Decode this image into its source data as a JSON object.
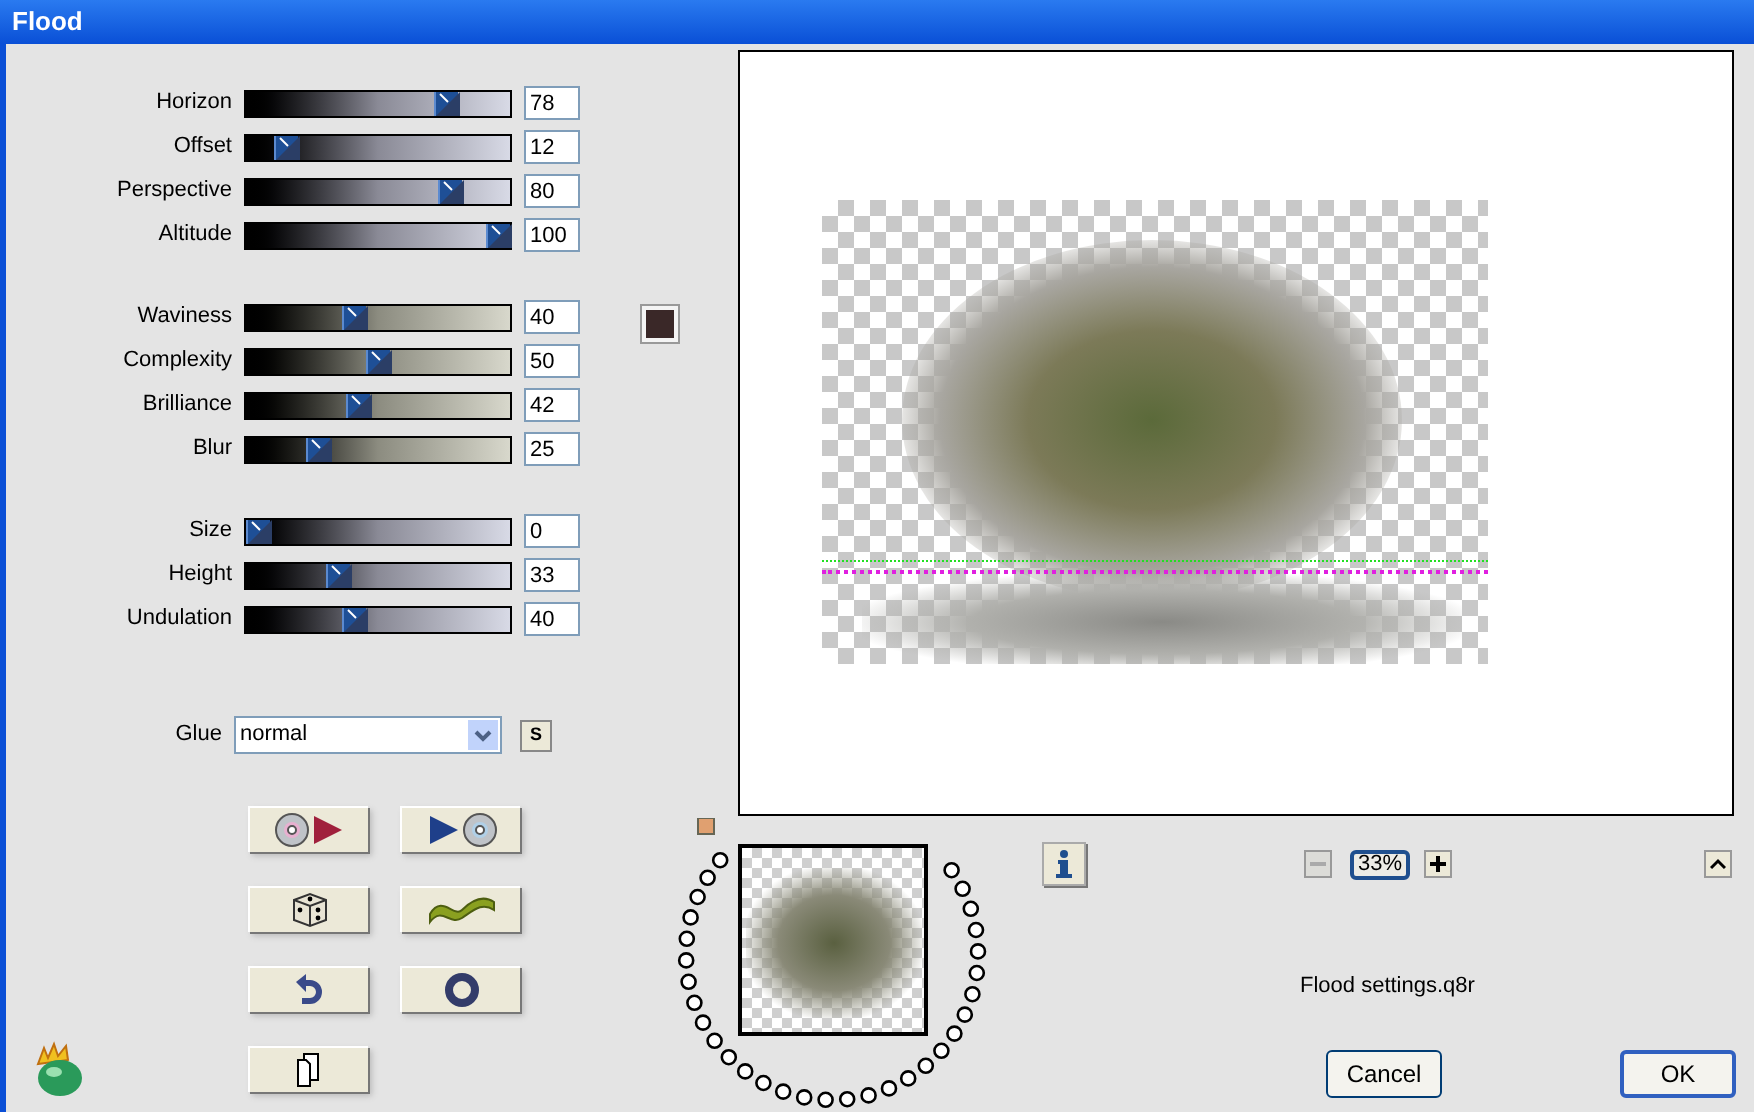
{
  "window": {
    "title": "Flood"
  },
  "slider_groups": [
    {
      "kind": "cool",
      "sliders": [
        {
          "label": "Horizon",
          "value": "78",
          "level": 0.78
        },
        {
          "label": "Offset",
          "value": "12",
          "level": 0.12
        },
        {
          "label": "Perspective",
          "value": "80",
          "level": 0.8
        },
        {
          "label": "Altitude",
          "value": "100",
          "level": 1
        }
      ]
    },
    {
      "kind": "warm",
      "swatch": {
        "color": "#3a2828"
      },
      "sliders": [
        {
          "label": "Waviness",
          "value": "40",
          "level": 0.4
        },
        {
          "label": "Complexity",
          "value": "50",
          "level": 0.5
        },
        {
          "label": "Brilliance",
          "value": "42",
          "level": 0.42
        },
        {
          "label": "Blur",
          "value": "25",
          "level": 0.25
        }
      ]
    },
    {
      "kind": "cool",
      "sliders": [
        {
          "label": "Size",
          "value": "0",
          "level": 0
        },
        {
          "label": "Height",
          "value": "33",
          "level": 0.33
        },
        {
          "label": "Undulation",
          "value": "40",
          "level": 0.4
        }
      ]
    }
  ],
  "glue": {
    "label": "Glue",
    "value": "normal",
    "side_button": "S"
  },
  "tool_buttons": [
    {
      "kind": "load"
    },
    {
      "kind": "save"
    },
    {
      "kind": "dice"
    },
    {
      "kind": "wave"
    },
    {
      "kind": "undo"
    },
    {
      "kind": "ring"
    },
    {
      "kind": "copy"
    }
  ],
  "zoom": {
    "value": "33%",
    "minus_disabled": true
  },
  "preset_name": "Flood settings.q8r",
  "buttons": [
    {
      "label": "Cancel",
      "default": false
    },
    {
      "label": "OK",
      "default": true
    }
  ]
}
